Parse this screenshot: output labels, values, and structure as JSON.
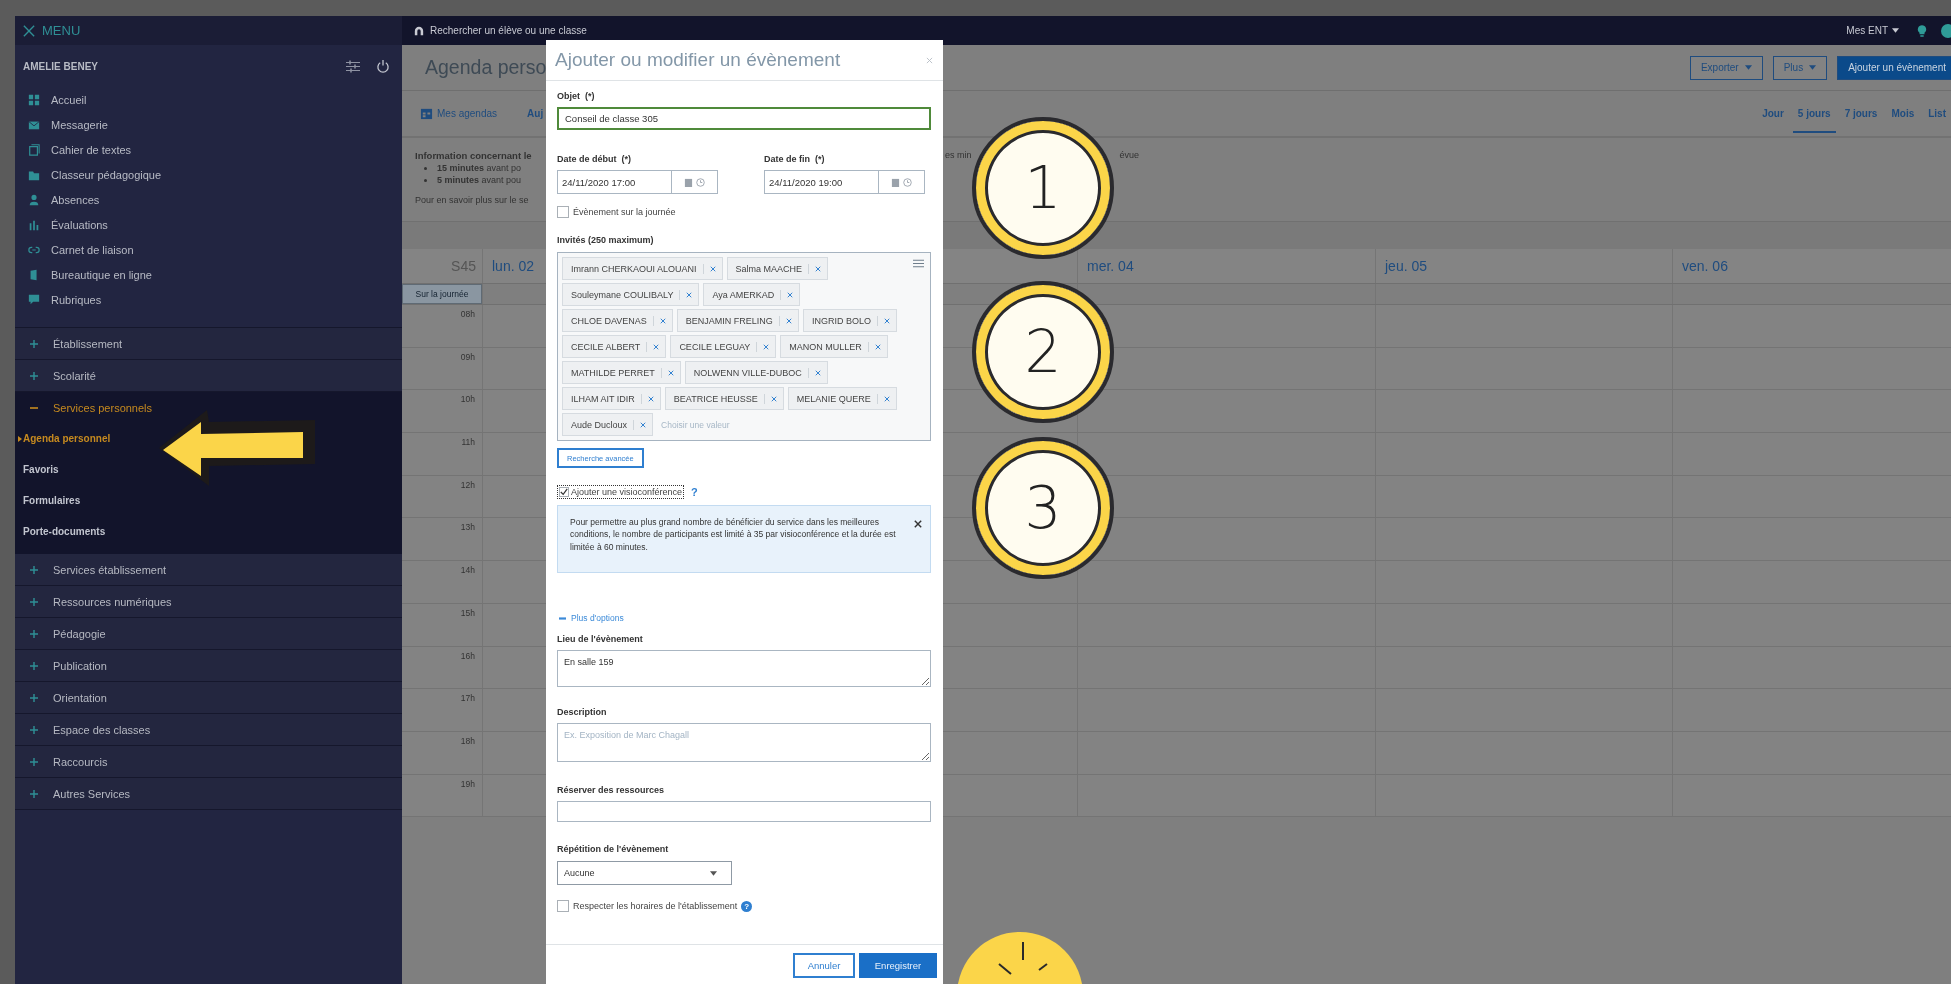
{
  "topbar": {
    "menu_label": "MENU",
    "search_placeholder": "Rechercher un élève ou une classe",
    "ent_menu": "Mes ENT"
  },
  "sidebar": {
    "user": "AMELIE BENEY",
    "apps": [
      "Accueil",
      "Messagerie",
      "Cahier de textes",
      "Classeur pédagogique",
      "Absences",
      "Évaluations",
      "Carnet de liaison",
      "Bureautique en ligne",
      "Rubriques"
    ],
    "sections": [
      {
        "label": "Établissement",
        "expanded": false
      },
      {
        "label": "Scolarité",
        "expanded": false
      },
      {
        "label": "Services personnels",
        "expanded": true,
        "children": [
          {
            "label": "Agenda personnel",
            "selected": true
          },
          {
            "label": "Favoris",
            "selected": false
          },
          {
            "label": "Formulaires",
            "selected": false
          },
          {
            "label": "Porte-documents",
            "selected": false
          }
        ]
      },
      {
        "label": "Services établissement",
        "expanded": false
      },
      {
        "label": "Ressources numériques",
        "expanded": false
      },
      {
        "label": "Pédagogie",
        "expanded": false
      },
      {
        "label": "Publication",
        "expanded": false
      },
      {
        "label": "Orientation",
        "expanded": false
      },
      {
        "label": "Espace des classes",
        "expanded": false
      },
      {
        "label": "Raccourcis",
        "expanded": false
      },
      {
        "label": "Autres Services",
        "expanded": false
      }
    ]
  },
  "page": {
    "title": "Agenda perso",
    "buttons": [
      {
        "label": "Exporter",
        "kind": "dropdown"
      },
      {
        "label": "Plus",
        "kind": "dropdown"
      },
      {
        "label": "Ajouter un évènement",
        "kind": "primary"
      }
    ],
    "my_calendars": "Mes agendas",
    "today": "Auj",
    "views": [
      {
        "label": "Jour",
        "selected": false
      },
      {
        "label": "5 jours",
        "selected": true
      },
      {
        "label": "7 jours",
        "selected": false
      },
      {
        "label": "Mois",
        "selected": false
      },
      {
        "label": "List",
        "selected": false
      }
    ]
  },
  "info": {
    "heading": "Information concernant le",
    "bullets": [
      "**15 minutes** avant po",
      "**5 minutes** avant pou"
    ],
    "more": "Pour en savoir plus sur le se",
    "fragment_1": "es min",
    "fragment_2": "évue"
  },
  "calendar": {
    "week": "S45",
    "days": [
      "lun. 02",
      "mer. 04",
      "jeu. 05",
      "ven. 06"
    ],
    "all_day": "Sur la journée",
    "hours": [
      "08h",
      "09h",
      "10h",
      "11h",
      "12h",
      "13h",
      "14h",
      "15h",
      "16h",
      "17h",
      "18h",
      "19h"
    ]
  },
  "modal": {
    "title": "Ajouter ou modifier un évènement",
    "subject": {
      "label": "Objet  (*)",
      "value": "Conseil de classe 305"
    },
    "start": {
      "label": "Date de début  (*)",
      "value": "24/11/2020 17:00"
    },
    "end": {
      "label": "Date de fin  (*)",
      "value": "24/11/2020 19:00"
    },
    "all_day": {
      "label": "Évènement sur la journée",
      "checked": false
    },
    "invitees": {
      "label": "Invités (250 maximum)",
      "placeholder": "Choisir une valeur",
      "people": [
        "Imrann CHERKAOUI ALOUANI",
        "Salma MAACHE",
        "Souleymane COULIBALY",
        "Aya AMERKAD",
        "CHLOE DAVENAS",
        "BENJAMIN FRELING",
        "INGRID BOLO",
        "CECILE ALBERT",
        "CECILE LEGUAY",
        "MANON MULLER",
        "MATHILDE PERRET",
        "NOLWENN VILLE-DUBOC",
        "ILHAM AIT IDIR",
        "BEATRICE HEUSSE",
        "MELANIE QUERE",
        "Aude Ducloux"
      ]
    },
    "advanced_search": "Recherche avancée",
    "visio": {
      "label": "Ajouter une visioconférence",
      "checked": true,
      "help": "?"
    },
    "visio_notice": "Pour permettre au plus grand nombre de bénéficier du service dans les meilleures conditions, le nombre de participants est limité à 35 par visioconférence et la durée est limitée à 60 minutes.",
    "more_options": "Plus d'options",
    "location": {
      "label": "Lieu de l'évènement",
      "value": "En salle 159"
    },
    "description": {
      "label": "Description",
      "placeholder": "Ex. Exposition de Marc Chagall"
    },
    "resources": {
      "label": "Réserver des ressources"
    },
    "repeat": {
      "label": "Répétition de l'évènement",
      "value": "Aucune"
    },
    "school_hours": {
      "label": "Respecter les horaires de l'établissement",
      "checked": false,
      "help": "?"
    },
    "cancel": "Annuler",
    "save": "Enregistrer"
  },
  "annotations": [
    "1",
    "2",
    "3"
  ]
}
